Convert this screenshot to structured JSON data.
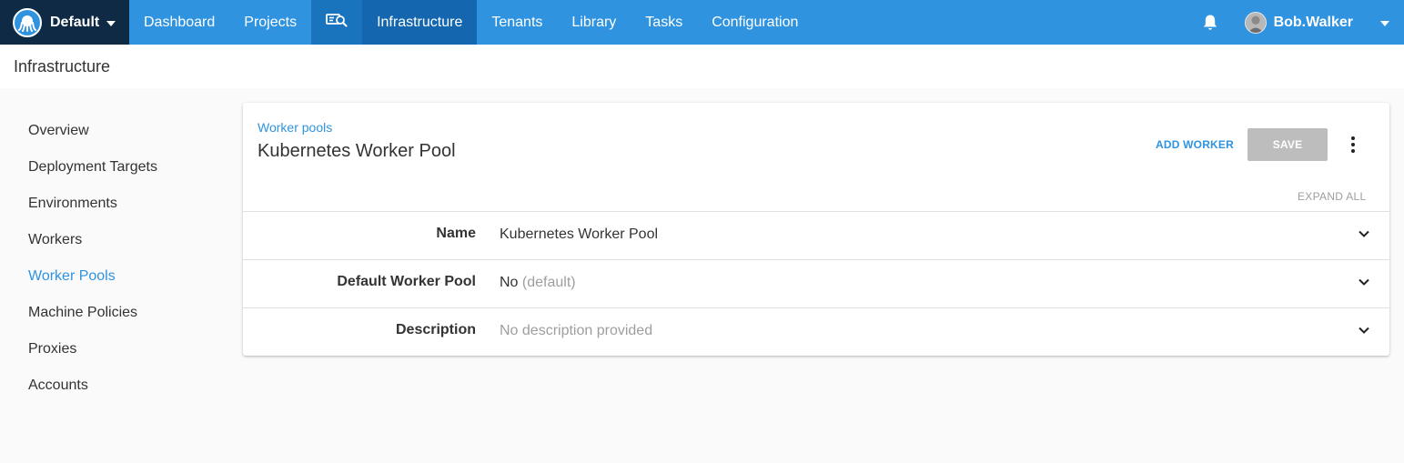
{
  "topnav": {
    "space": "Default",
    "items": [
      {
        "label": "Dashboard"
      },
      {
        "label": "Projects"
      },
      {
        "label": "Infrastructure"
      },
      {
        "label": "Tenants"
      },
      {
        "label": "Library"
      },
      {
        "label": "Tasks"
      },
      {
        "label": "Configuration"
      }
    ],
    "user": "Bob.Walker"
  },
  "page": {
    "title": "Infrastructure"
  },
  "sidebar": {
    "items": [
      {
        "label": "Overview"
      },
      {
        "label": "Deployment Targets"
      },
      {
        "label": "Environments"
      },
      {
        "label": "Workers"
      },
      {
        "label": "Worker Pools"
      },
      {
        "label": "Machine Policies"
      },
      {
        "label": "Proxies"
      },
      {
        "label": "Accounts"
      }
    ]
  },
  "card": {
    "breadcrumb": "Worker pools",
    "title": "Kubernetes Worker Pool",
    "add_worker": "ADD WORKER",
    "save": "SAVE",
    "expand_all": "EXPAND ALL",
    "rows": [
      {
        "label": "Name",
        "value": "Kubernetes Worker Pool",
        "hint": ""
      },
      {
        "label": "Default Worker Pool",
        "value": "No",
        "hint": "(default)"
      },
      {
        "label": "Description",
        "value": "",
        "hint": "No description provided"
      }
    ]
  },
  "colors": {
    "brand": "#2f93e0",
    "nav_active": "#1467ae",
    "space_bg": "#0e2a45",
    "disabled": "#bdbdbd"
  }
}
